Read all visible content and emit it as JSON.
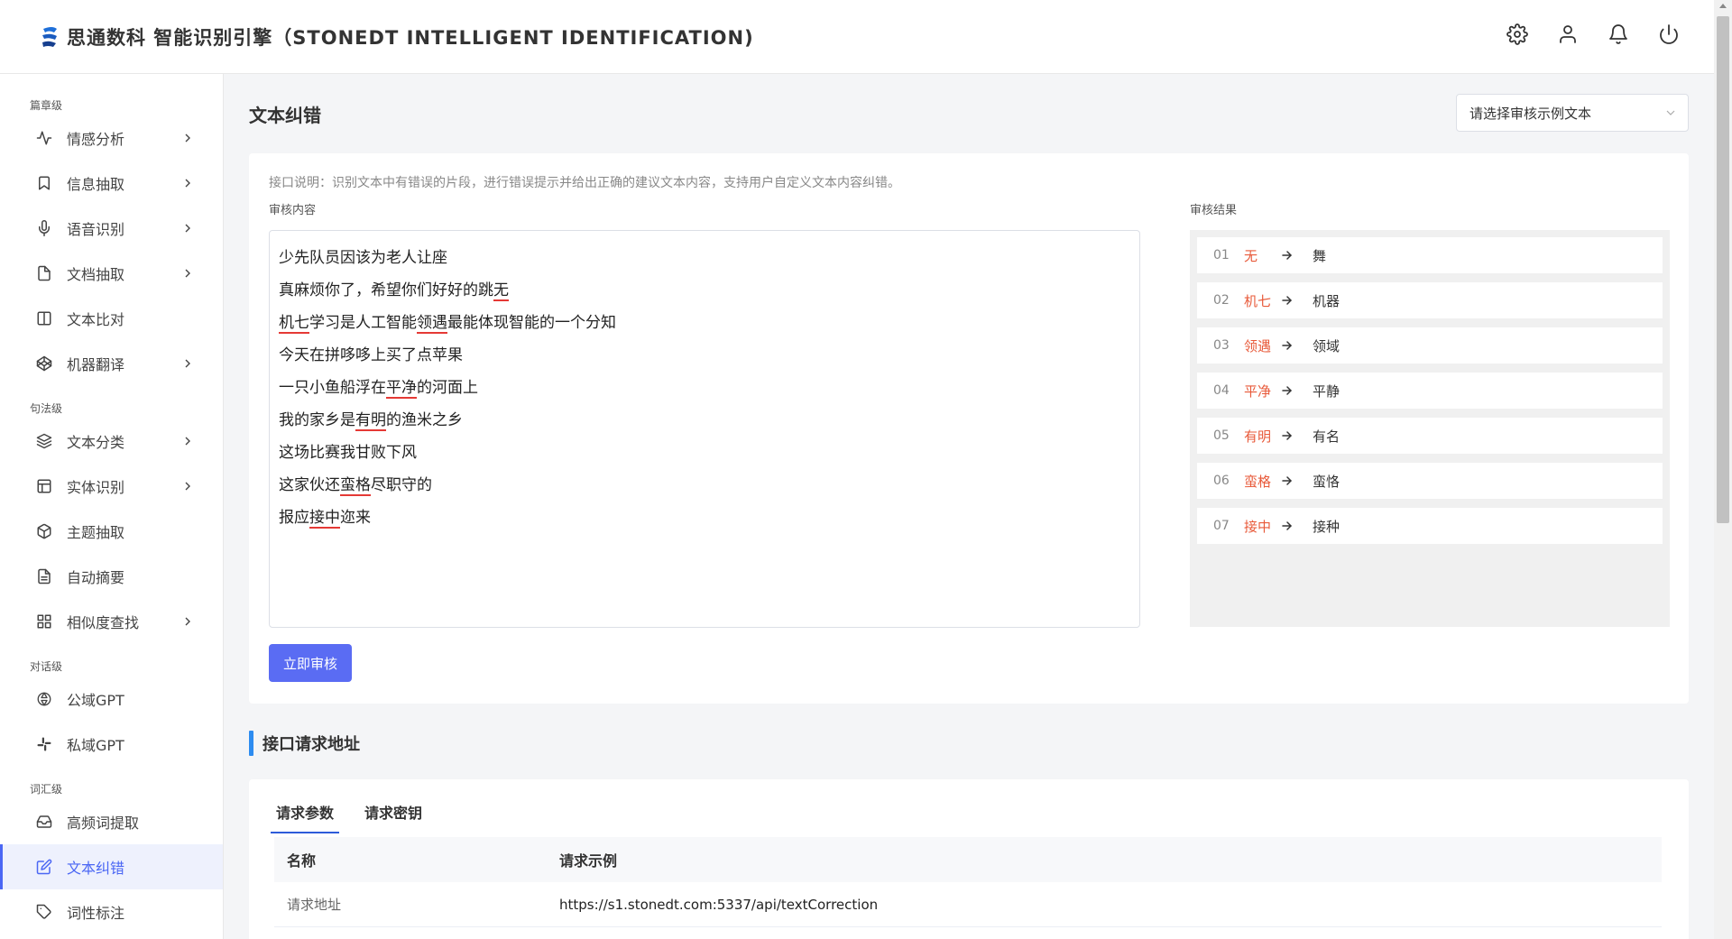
{
  "header": {
    "title": "思通数科 智能识别引擎（STONEDT INTELLIGENT IDENTIFICATION)",
    "icons": [
      "gear-icon",
      "user-icon",
      "bell-icon",
      "power-icon"
    ]
  },
  "sidebar": {
    "groups": [
      {
        "label": "篇章级",
        "items": [
          {
            "label": "情感分析",
            "icon": "pulse-icon",
            "chevron": true
          },
          {
            "label": "信息抽取",
            "icon": "bookmark-icon",
            "chevron": true
          },
          {
            "label": "语音识别",
            "icon": "microphone-icon",
            "chevron": true
          },
          {
            "label": "文档抽取",
            "icon": "document-icon",
            "chevron": true
          },
          {
            "label": "文本比对",
            "icon": "columns-icon",
            "chevron": false
          },
          {
            "label": "机器翻译",
            "icon": "codepen-icon",
            "chevron": true
          }
        ]
      },
      {
        "label": "句法级",
        "items": [
          {
            "label": "文本分类",
            "icon": "layers-icon",
            "chevron": true
          },
          {
            "label": "实体识别",
            "icon": "layout-icon",
            "chevron": true
          },
          {
            "label": "主题抽取",
            "icon": "package-icon",
            "chevron": false
          },
          {
            "label": "自动摘要",
            "icon": "file-text-icon",
            "chevron": false
          },
          {
            "label": "相似度查找",
            "icon": "grid-icon",
            "chevron": true
          }
        ]
      },
      {
        "label": "对话级",
        "items": [
          {
            "label": "公域GPT",
            "icon": "openai-icon",
            "chevron": false
          },
          {
            "label": "私域GPT",
            "icon": "slack-icon",
            "chevron": false
          }
        ]
      },
      {
        "label": "词汇级",
        "items": [
          {
            "label": "高频词提取",
            "icon": "inbox-icon",
            "chevron": false
          },
          {
            "label": "文本纠错",
            "icon": "edit-icon",
            "chevron": false,
            "active": true
          },
          {
            "label": "词性标注",
            "icon": "tag-icon",
            "chevron": false
          }
        ]
      }
    ]
  },
  "main": {
    "page_title": "文本纠错",
    "example_select": {
      "placeholder": "请选择审核示例文本"
    },
    "api_description": "接口说明：识别文本中有错误的片段，进行错误提示并给出正确的建议文本内容，支持用户自定义文本内容纠错。",
    "input_label": "审核内容",
    "result_label": "审核结果",
    "text_lines": [
      [
        {
          "t": "少先队员因该为老人让座"
        }
      ],
      [
        {
          "t": "真麻烦你了，希望你们好好的跳"
        },
        {
          "t": "无",
          "err": true
        }
      ],
      [
        {
          "t": "机七",
          "err": true
        },
        {
          "t": "学习是人工智能"
        },
        {
          "t": "领遇",
          "err": true
        },
        {
          "t": "最能体现智能的一个分知"
        }
      ],
      [
        {
          "t": "今天在拼哆哆上买了点苹果"
        }
      ],
      [
        {
          "t": "一只小鱼船浮在"
        },
        {
          "t": "平净",
          "err": true
        },
        {
          "t": "的河面上"
        }
      ],
      [
        {
          "t": "我的家乡是"
        },
        {
          "t": "有明",
          "err": true
        },
        {
          "t": "的渔米之乡"
        }
      ],
      [
        {
          "t": "这场比赛我甘败下风"
        }
      ],
      [
        {
          "t": "这家伙还"
        },
        {
          "t": "蛮格",
          "err": true
        },
        {
          "t": "尽职守的"
        }
      ],
      [
        {
          "t": "报应"
        },
        {
          "t": "接中",
          "err": true
        },
        {
          "t": "迩来"
        }
      ]
    ],
    "results": [
      {
        "num": "01",
        "wrong": "无",
        "right": "舞"
      },
      {
        "num": "02",
        "wrong": "机七",
        "right": "机器"
      },
      {
        "num": "03",
        "wrong": "领遇",
        "right": "领域"
      },
      {
        "num": "04",
        "wrong": "平净",
        "right": "平静"
      },
      {
        "num": "05",
        "wrong": "有明",
        "right": "有名"
      },
      {
        "num": "06",
        "wrong": "蛮格",
        "right": "蛮恪"
      },
      {
        "num": "07",
        "wrong": "接中",
        "right": "接种"
      }
    ],
    "submit_label": "立即审核",
    "section_title": "接口请求地址",
    "tabs": [
      {
        "label": "请求参数",
        "active": true
      },
      {
        "label": "请求密钥",
        "active": false
      }
    ],
    "table": {
      "headers": [
        "名称",
        "请求示例"
      ],
      "rows": [
        [
          "请求地址",
          "https://s1.stonedt.com:5337/api/textCorrection"
        ]
      ]
    }
  },
  "colors": {
    "accent": "#5a6cf3",
    "error": "#e53935",
    "wrong_text": "#e85a3a",
    "section_bar": "#2d8cf0"
  }
}
